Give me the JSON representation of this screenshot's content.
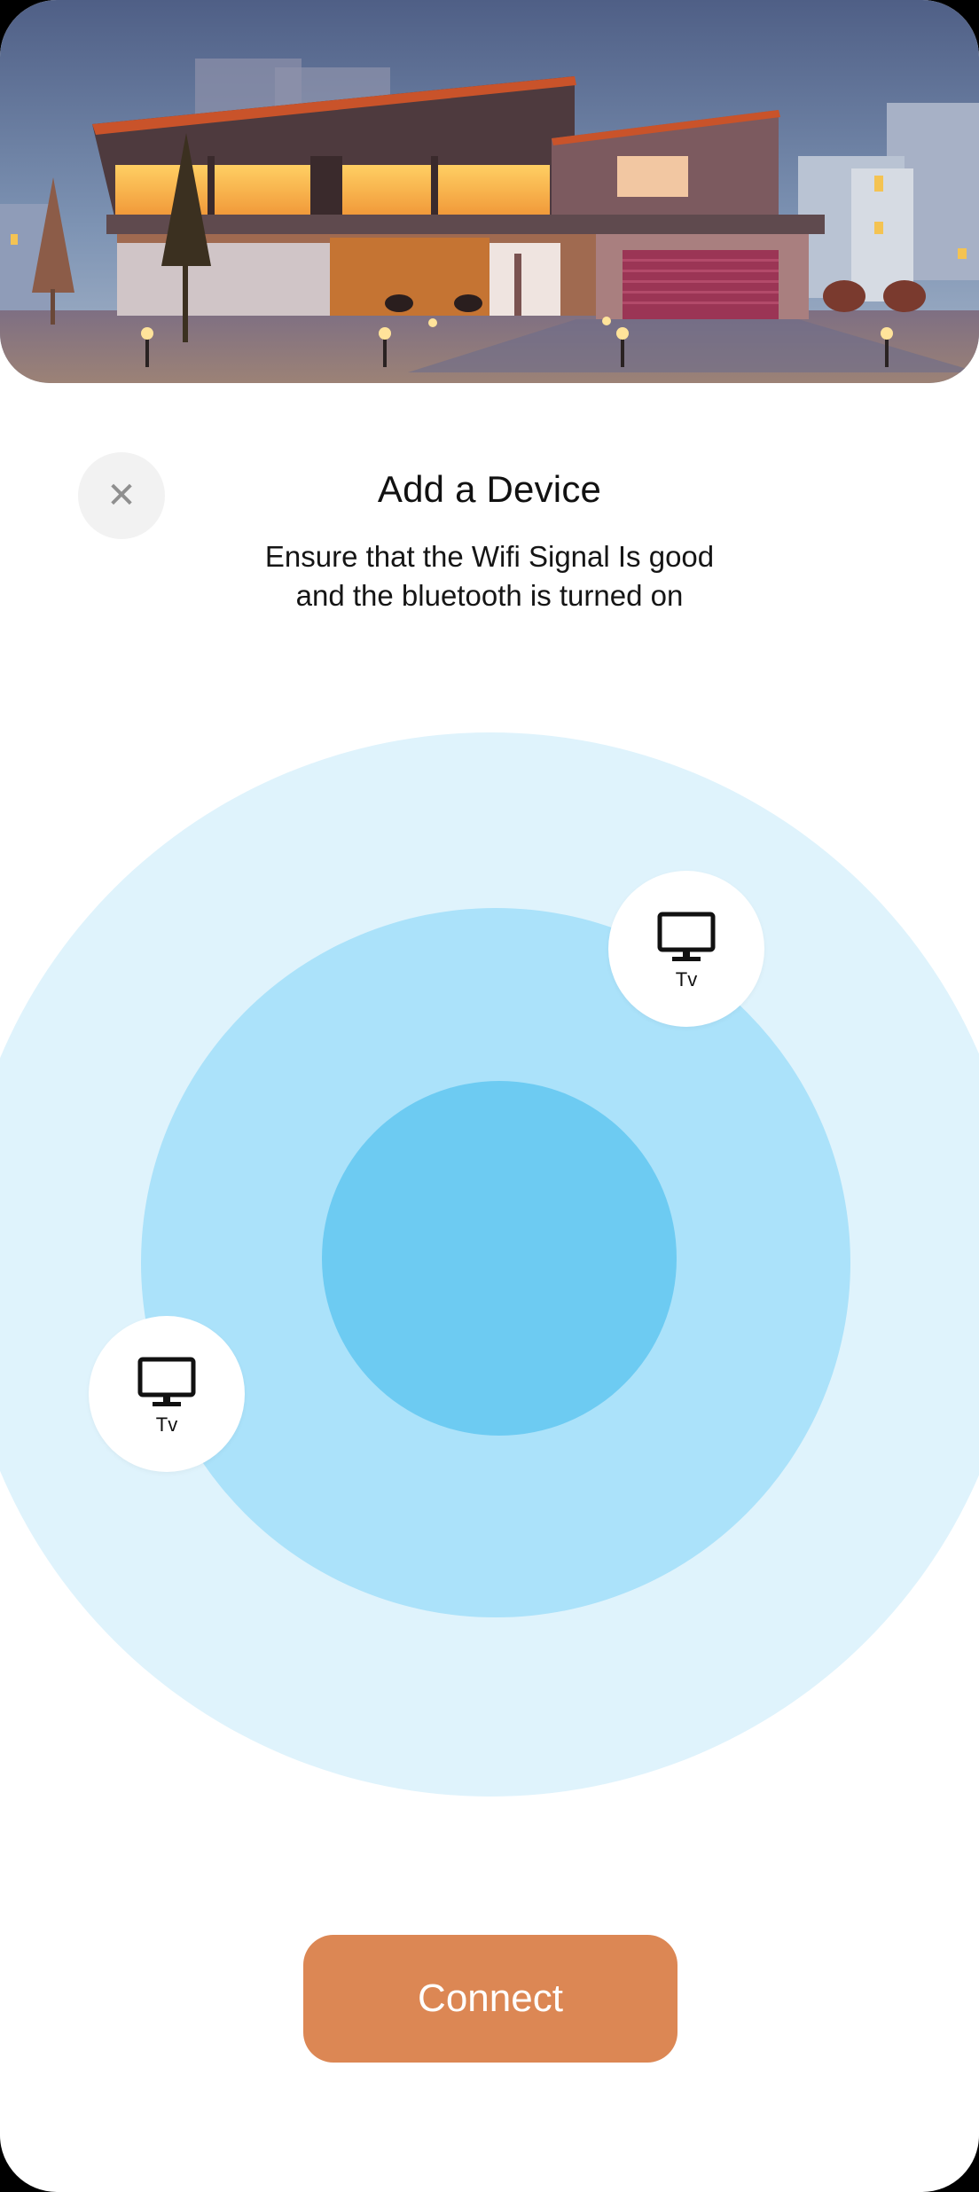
{
  "header": {
    "title": "Add a Device",
    "subtitle_line1": "Ensure that the Wifi Signal Is good",
    "subtitle_line2": "and the bluetooth is turned on"
  },
  "close_button": {
    "icon": "close-icon",
    "glyph": "✕"
  },
  "devices": [
    {
      "label": "Tv",
      "icon": "tv-icon"
    },
    {
      "label": "Tv",
      "icon": "tv-icon"
    }
  ],
  "connect_button": {
    "label": "Connect"
  },
  "colors": {
    "accent": "#dc8754",
    "radar_outer": "#dff3fc",
    "radar_middle": "#abe2fa",
    "radar_inner": "#6dcbf2",
    "close_bg": "#f2f2f2"
  }
}
